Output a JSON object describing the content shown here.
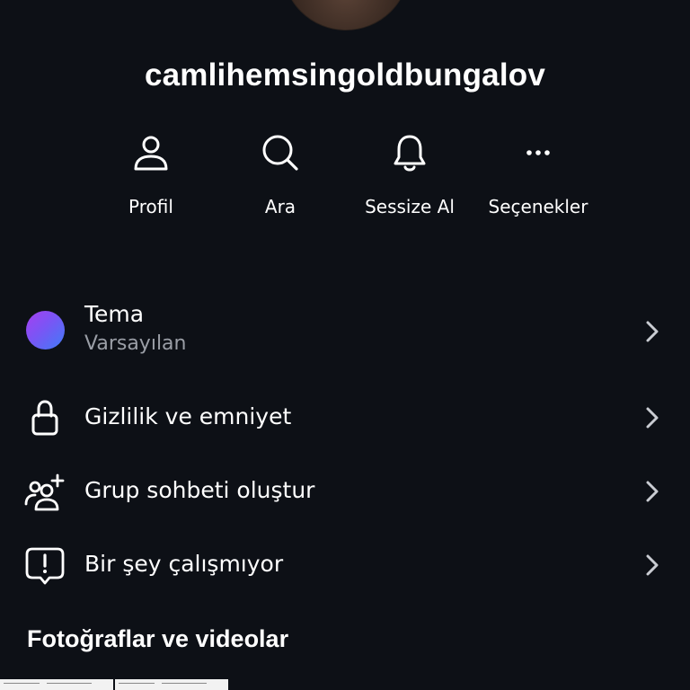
{
  "profile": {
    "username": "camlihemsingoldbungalov"
  },
  "actions": [
    {
      "label": "Profil",
      "icon": "person-icon"
    },
    {
      "label": "Ara",
      "icon": "search-icon"
    },
    {
      "label": "Sessize Al",
      "icon": "bell-icon"
    },
    {
      "label": "Seçenekler",
      "icon": "more-icon"
    }
  ],
  "settings": [
    {
      "title": "Tema",
      "subtitle": "Varsayılan",
      "icon": "theme-gradient-dot"
    },
    {
      "title": "Gizlilik ve emniyet",
      "icon": "lock-icon"
    },
    {
      "title": "Grup sohbeti oluştur",
      "icon": "add-people-icon"
    },
    {
      "title": "Bir şey çalışmıyor",
      "icon": "report-problem-icon"
    }
  ],
  "media": {
    "title": "Fotoğraflar ve videolar"
  },
  "colors": {
    "background": "#0d1016",
    "text": "#ffffff",
    "muted": "#9a9ea6",
    "chevron": "#c9ccd2",
    "theme_gradient": [
      "#a63ff0",
      "#3f7cf6"
    ]
  }
}
